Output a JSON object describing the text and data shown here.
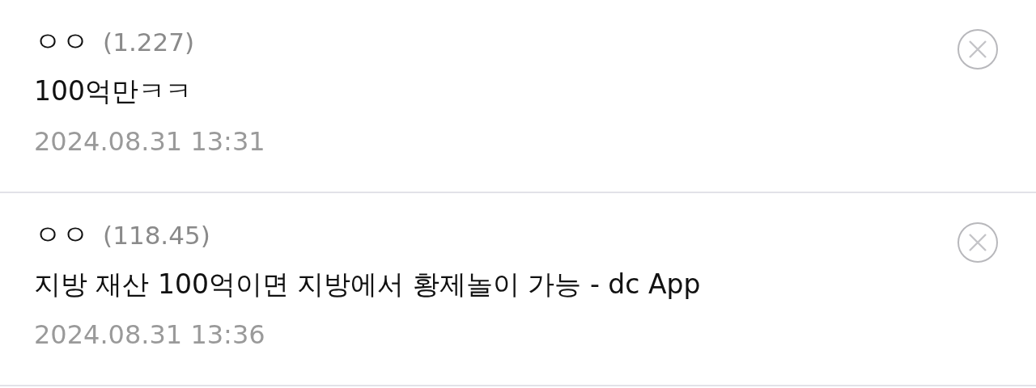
{
  "comments": [
    {
      "author": "ㅇㅇ",
      "ip": "(1.227)",
      "text": "100억만ㅋㅋ",
      "date": "2024.08.31 13:31"
    },
    {
      "author": "ㅇㅇ",
      "ip": "(118.45)",
      "text": "지방 재산 100억이면 지방에서 황제놀이 가능 - dc App",
      "date": "2024.08.31 13:36"
    }
  ]
}
